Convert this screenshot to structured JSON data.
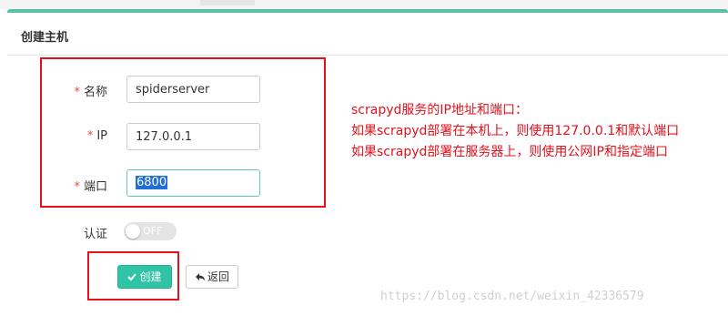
{
  "modal": {
    "title": "创建主机",
    "accent_color": "#5bc0a8"
  },
  "form": {
    "name": {
      "label": "名称",
      "required": "*",
      "value": "spiderserver"
    },
    "ip": {
      "label": "IP",
      "required": "*",
      "value": "127.0.0.1"
    },
    "port": {
      "label": "端口",
      "required": "*",
      "value": "6800"
    },
    "auth": {
      "label": "认证",
      "toggle_state": "OFF"
    }
  },
  "buttons": {
    "create_label": "创建",
    "create_icon": "check-icon",
    "back_label": "返回",
    "back_icon": "reply-icon",
    "create_color": "#2ec4a5"
  },
  "annotation": {
    "color": "#e4101b",
    "lines": [
      "scrapyd服务的IP地址和端口：",
      "如果scrapyd部署在本机上，则使用127.0.0.1和默认端口",
      "如果scrapyd部署在服务器上，则使用公网IP和指定端口"
    ]
  },
  "watermark": "https://blog.csdn.net/weixin_42336579"
}
